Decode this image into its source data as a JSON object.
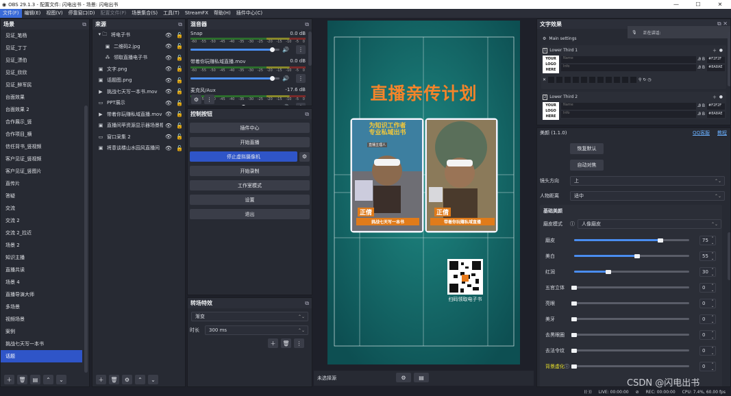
{
  "window": {
    "title": "OBS 29.1.3 - 配置文件: 闪电出书 - 场景: 闪电出书",
    "controls": [
      "—",
      "☐",
      "✕"
    ]
  },
  "menu": [
    {
      "label": "文件(F)",
      "active": true,
      "dim": false
    },
    {
      "label": "编辑(E)",
      "active": false,
      "dim": false
    },
    {
      "label": "视图(V)",
      "active": false,
      "dim": false
    },
    {
      "label": "停靠窗口(D)",
      "active": false,
      "dim": false
    },
    {
      "label": "配置文件(P)",
      "active": false,
      "dim": true
    },
    {
      "label": "场景集合(S)",
      "active": false,
      "dim": false
    },
    {
      "label": "工具(T)",
      "active": false,
      "dim": false
    },
    {
      "label": "StreamFX",
      "active": false,
      "dim": false
    },
    {
      "label": "帮助(H)",
      "active": false,
      "dim": false
    },
    {
      "label": "插件中心(C)",
      "active": false,
      "dim": false
    }
  ],
  "scenes": {
    "title": "场景",
    "items": [
      "见证_笔杨",
      "见证_丁丁",
      "见证_漂伯",
      "见证_欣欣",
      "见证_醉军民",
      "台面效果",
      "台面效果 2",
      "合作展示_竖",
      "合作项目_横",
      "信任背书_竖视频",
      "客户见证_竖视频",
      "客户见证_竖图片",
      "直传片",
      "答疑",
      "交流",
      "交流 2",
      "交流 2_拉近",
      "场景 2",
      "知识主播",
      "直播共读",
      "场景 4",
      "直播导演大师",
      "多场景",
      "视频场景",
      "案例",
      "挑战七天写一本书",
      "话题"
    ],
    "selected_index": 26
  },
  "sources": {
    "title": "来源",
    "items": [
      {
        "icon": "▾ 🗀",
        "name": "将电子书",
        "indent": 0
      },
      {
        "icon": "▣",
        "name": "二维码2.jpg",
        "indent": 1
      },
      {
        "icon": "⁂",
        "name": "领取直播电子书",
        "indent": 1
      },
      {
        "icon": "▣",
        "name": "文字.png",
        "indent": 0
      },
      {
        "icon": "▣",
        "name": "话题图.png",
        "indent": 0
      },
      {
        "icon": "▶",
        "name": "挑战七天写一本书.mov",
        "indent": 0
      },
      {
        "icon": "▭",
        "name": "PPT展示",
        "indent": 0
      },
      {
        "icon": "▶",
        "name": "带着你玩赚私域直播.mov",
        "indent": 0
      },
      {
        "icon": "▣",
        "name": "直播间苹资源显示器场景框",
        "indent": 0
      },
      {
        "icon": "▭",
        "name": "窗口采集 2",
        "indent": 0
      },
      {
        "icon": "▣",
        "name": "将意谈楼山水园风直播间",
        "indent": 0
      }
    ]
  },
  "mixer": {
    "title": "混音器",
    "channels": [
      {
        "name": "Snap",
        "db": "0.0 dB",
        "level": 0.92
      },
      {
        "name": "带着你玩赚私域直播.mov",
        "db": "0.0 dB",
        "level": 0.92
      },
      {
        "name": "麦克风/Aux",
        "db": "-17.6 dB",
        "level": 0.6
      }
    ],
    "ticks": [
      "-60",
      "-55",
      "-50",
      "-45",
      "-40",
      "-35",
      "-30",
      "-25",
      "-20",
      "-15",
      "-10",
      "-5",
      "0"
    ]
  },
  "controls": {
    "title": "控制按钮",
    "buttons": [
      {
        "label": "插件中心",
        "primary": false
      },
      {
        "label": "开始直播",
        "primary": false
      },
      {
        "label": "停止虚拟摄像机",
        "primary": true
      },
      {
        "label": "开始录制",
        "primary": false
      },
      {
        "label": "工作室模式",
        "primary": false
      },
      {
        "label": "设置",
        "primary": false
      },
      {
        "label": "退出",
        "primary": false
      }
    ]
  },
  "transition": {
    "title": "转场特效",
    "type": "渐变",
    "duration_label": "时长",
    "duration": "300 ms"
  },
  "preview": {
    "headline": "直播亲传计划",
    "card_left": {
      "top": "为知识工作者\n专业私域出书",
      "badge": "直播主理人",
      "name": "正倩",
      "tag": "挑战七天写一本书"
    },
    "card_right": {
      "name": "正倩",
      "tag": "带着你玩赚私域直播"
    },
    "qr_caption": "扫码领取电子书",
    "no_source": "未选择源"
  },
  "textfx": {
    "title": "文字效果",
    "speaking": "正在讲话:",
    "main_settings": "Main settings",
    "lower_thirds": [
      {
        "label": "Lower Third 1",
        "logo": "YOUR LOGO HERE",
        "name_ph": "Name",
        "info_ph": "Info",
        "color1": "#F2F2F",
        "color2": "#8A8AE"
      },
      {
        "label": "Lower Third 2",
        "logo": "YOUR LOGO HERE",
        "name_ph": "Name",
        "info_ph": "Info",
        "color1": "#F2F2F",
        "color2": "#8A8AE"
      }
    ]
  },
  "beauty": {
    "title": "美颜 (1.1.0)",
    "qq": "QQ客服",
    "help": "教程",
    "btn_default": "恢复默认",
    "btn_auto": "自动对焦",
    "lens_label": "镜头方向",
    "lens_value": "上",
    "distance_label": "人物距离",
    "distance_value": "适中",
    "section": "基础美颜",
    "mode_label": "磨皮模式",
    "mode_value": "人像磨皮",
    "sliders": [
      {
        "label": "磨皮",
        "value": 75
      },
      {
        "label": "美白",
        "value": 55
      },
      {
        "label": "红润",
        "value": 30
      },
      {
        "label": "五官立体",
        "value": 0
      },
      {
        "label": "亮眼",
        "value": 0
      },
      {
        "label": "美牙",
        "value": 0
      },
      {
        "label": "去黑眼圈",
        "value": 0
      },
      {
        "label": "去法令纹",
        "value": 0
      },
      {
        "label": "背景虚化",
        "value": 0
      }
    ]
  },
  "status": {
    "live": "LIVE: 00:00:00",
    "rec": "REC: 00:00:00",
    "cpu": "CPU: 7.4%, 60.00 fps",
    "watermark": "CSDN @闪电出书"
  }
}
